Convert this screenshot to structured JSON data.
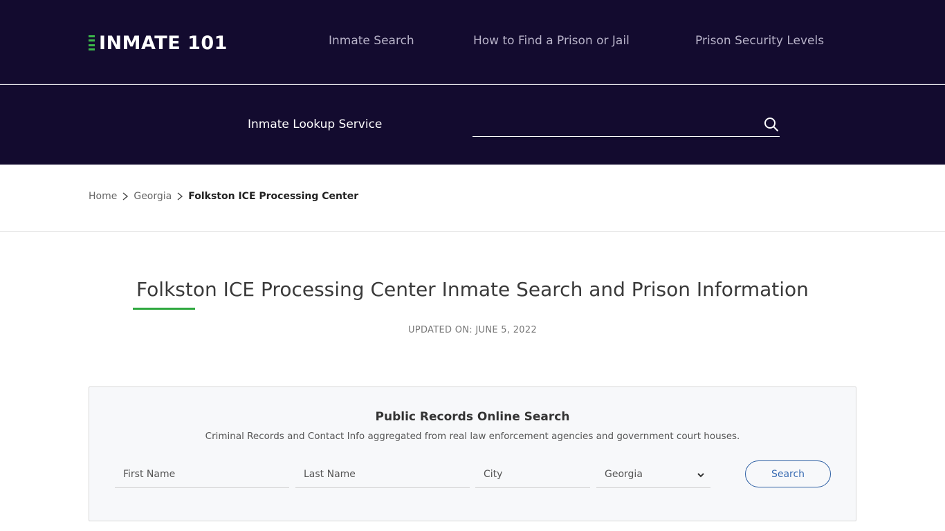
{
  "header": {
    "logo_text": "INMATE 101",
    "brand_accent": "#3cb84a",
    "background": "#130b2f",
    "nav": [
      {
        "label": "Inmate Search"
      },
      {
        "label": "How to Find a Prison or Jail"
      },
      {
        "label": "Prison Security Levels"
      }
    ]
  },
  "lookup": {
    "label": "Inmate Lookup Service",
    "input_value": "",
    "search_icon": "search-icon"
  },
  "breadcrumb": {
    "items": [
      {
        "label": "Home"
      },
      {
        "label": "Georgia"
      },
      {
        "label": "Folkston ICE Processing Center"
      }
    ],
    "separator_icon": "chevron-right-icon"
  },
  "main": {
    "title": "Folkston ICE Processing Center Inmate Search and Prison Information",
    "updated": "UPDATED ON: JUNE 5, 2022",
    "underline_color": "#2ea83e"
  },
  "records": {
    "title": "Public Records Online Search",
    "subtitle": "Criminal Records and Contact Info aggregated from real law enforcement agencies and government court houses.",
    "first_name_placeholder": "First Name",
    "last_name_placeholder": "Last Name",
    "city_placeholder": "City",
    "state_selected": "Georgia",
    "search_label": "Search",
    "button_color": "#2d5fa3"
  }
}
